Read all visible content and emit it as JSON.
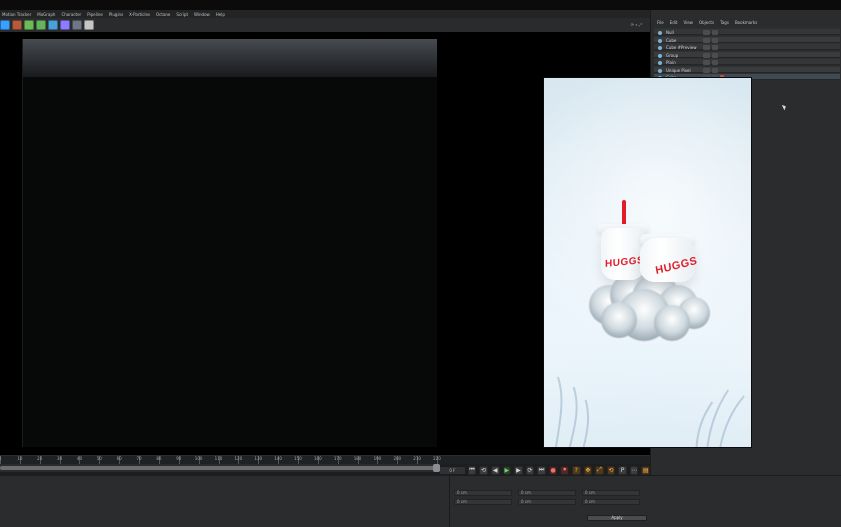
{
  "menubar": {
    "items": [
      "Motion Tracker",
      "MoGraph",
      "Character",
      "Pipeline",
      "Plugins",
      "X-Particles",
      "Octane",
      "Script",
      "Window",
      "Help"
    ]
  },
  "toolbar": {
    "right_hint": "⟳ ⌕ ⤢",
    "icons": [
      {
        "name": "render-view-icon",
        "color": "#3aa0ff"
      },
      {
        "name": "picture-viewer-icon",
        "color": "#b45a3d"
      },
      {
        "name": "render-settings-icon",
        "color": "#6dbb58"
      },
      {
        "name": "object-icon",
        "color": "#66b35d"
      },
      {
        "name": "spline-icon",
        "color": "#4aa0d8"
      },
      {
        "name": "tag-icon",
        "color": "#8c7cff"
      },
      {
        "name": "camera-icon",
        "color": "#6d7785"
      },
      {
        "name": "light-icon",
        "color": "#c6c6c6"
      }
    ]
  },
  "object_manager": {
    "menu": [
      "File",
      "Edit",
      "View",
      "Objects",
      "Tags",
      "Bookmarks"
    ],
    "rows": [
      {
        "label": "Null"
      },
      {
        "label": "Cube"
      },
      {
        "label": "Cube #Preview"
      },
      {
        "label": "Group"
      },
      {
        "label": "Plain"
      },
      {
        "label": "Unique Pixel"
      },
      {
        "label": "Cube"
      }
    ]
  },
  "timeline": {
    "ticks": [
      "0",
      "10",
      "20",
      "30",
      "40",
      "50",
      "60",
      "70",
      "80",
      "90",
      "100",
      "110",
      "120",
      "130",
      "140",
      "150",
      "160",
      "170",
      "180",
      "190",
      "200",
      "210",
      "220"
    ],
    "current_frame": "0 F",
    "end_frame": "220 F"
  },
  "transport": {
    "buttons": [
      {
        "name": "go-to-start-button",
        "glyph": "⏮"
      },
      {
        "name": "prev-key-button",
        "glyph": "⟲"
      },
      {
        "name": "prev-frame-button",
        "glyph": "◀"
      },
      {
        "name": "play-button",
        "glyph": "▶"
      },
      {
        "name": "next-frame-button",
        "glyph": "▶"
      },
      {
        "name": "next-key-button",
        "glyph": "⟳"
      },
      {
        "name": "go-to-end-button",
        "glyph": "⏭"
      }
    ],
    "record_buttons": [
      {
        "name": "record-button",
        "glyph": "●"
      },
      {
        "name": "autokey-button",
        "glyph": "⏺"
      },
      {
        "name": "keyframe-selection-button",
        "glyph": "?"
      }
    ],
    "tools": [
      {
        "name": "move-tool-button",
        "glyph": "✥"
      },
      {
        "name": "scale-tool-button",
        "glyph": "⤢"
      },
      {
        "name": "rotate-tool-button",
        "glyph": "⟲"
      },
      {
        "name": "param-tool-button",
        "glyph": "P"
      },
      {
        "name": "grid-tool-button",
        "glyph": "⋯"
      },
      {
        "name": "timeline-tool-button",
        "glyph": "▤"
      }
    ]
  },
  "bottom": {
    "fields": [
      "0 cm",
      "0 cm",
      "0 cm",
      "0 cm",
      "0 cm",
      "0 cm"
    ],
    "apply_label": "Apply"
  },
  "preview": {
    "brand_left": "HUGGS",
    "brand_right": "HUGGS"
  }
}
